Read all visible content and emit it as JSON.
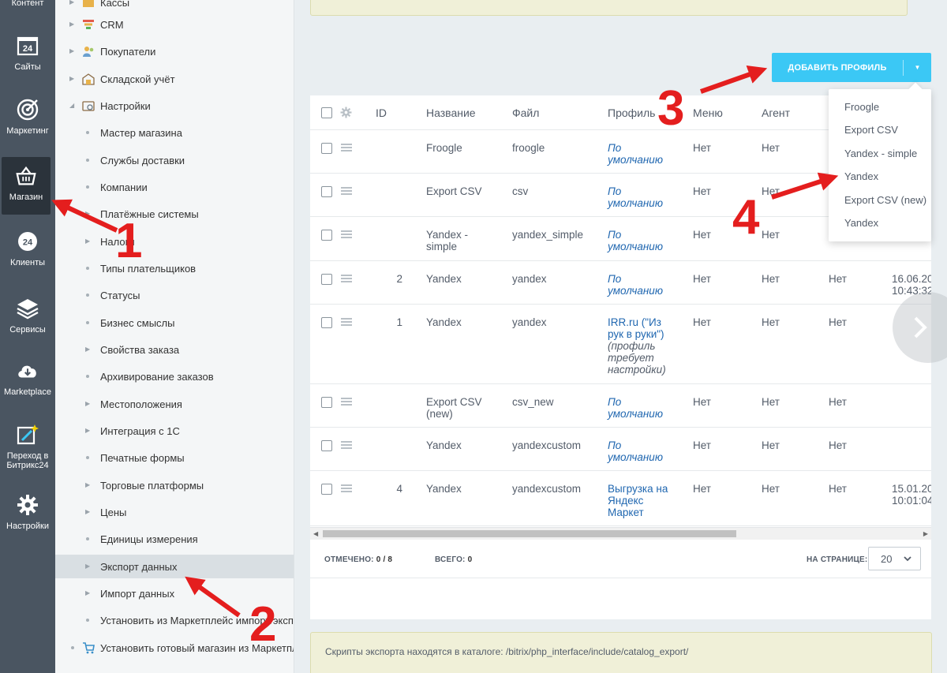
{
  "rail": {
    "items": [
      {
        "label": "Контент",
        "icon": "content-icon"
      },
      {
        "label": "Сайты",
        "icon": "sites-24-icon"
      },
      {
        "label": "Маркетинг",
        "icon": "target-icon"
      },
      {
        "label": "Магазин",
        "icon": "basket-icon",
        "active": true
      },
      {
        "label": "Клиенты",
        "icon": "clients-24-icon"
      },
      {
        "label": "Сервисы",
        "icon": "layers-icon"
      },
      {
        "label": "Marketplace",
        "icon": "cloud-download-icon"
      },
      {
        "label": "Переход в Битрикс24",
        "icon": "magic-wand-icon"
      },
      {
        "label": "Настройки",
        "icon": "gear-icon"
      }
    ]
  },
  "tree": {
    "items": [
      {
        "label": "Кассы",
        "level": 0,
        "type": "folder"
      },
      {
        "label": "CRM",
        "level": 0,
        "type": "folder"
      },
      {
        "label": "Покупатели",
        "level": 0,
        "type": "folder"
      },
      {
        "label": "Складской учёт",
        "level": 0,
        "type": "folder"
      },
      {
        "label": "Настройки",
        "level": 0,
        "type": "folder-open"
      },
      {
        "label": "Мастер магазина",
        "level": 1,
        "type": "leaf"
      },
      {
        "label": "Службы доставки",
        "level": 1,
        "type": "leaf"
      },
      {
        "label": "Компании",
        "level": 1,
        "type": "leaf"
      },
      {
        "label": "Платёжные системы",
        "level": 1,
        "type": "branch"
      },
      {
        "label": "Налоги",
        "level": 1,
        "type": "branch"
      },
      {
        "label": "Типы плательщиков",
        "level": 1,
        "type": "leaf"
      },
      {
        "label": "Статусы",
        "level": 1,
        "type": "leaf"
      },
      {
        "label": "Бизнес смыслы",
        "level": 1,
        "type": "leaf"
      },
      {
        "label": "Свойства заказа",
        "level": 1,
        "type": "branch"
      },
      {
        "label": "Архивирование заказов",
        "level": 1,
        "type": "leaf"
      },
      {
        "label": "Местоположения",
        "level": 1,
        "type": "branch"
      },
      {
        "label": "Интеграция с 1С",
        "level": 1,
        "type": "branch"
      },
      {
        "label": "Печатные формы",
        "level": 1,
        "type": "leaf"
      },
      {
        "label": "Торговые платформы",
        "level": 1,
        "type": "branch"
      },
      {
        "label": "Цены",
        "level": 1,
        "type": "branch"
      },
      {
        "label": "Единицы измерения",
        "level": 1,
        "type": "leaf"
      },
      {
        "label": "Экспорт данных",
        "level": 1,
        "type": "branch",
        "selected": true
      },
      {
        "label": "Импорт данных",
        "level": 1,
        "type": "branch"
      },
      {
        "label": "Установить из Маркетплейс импорт/экспорт",
        "level": 1,
        "type": "leaf"
      },
      {
        "label": "Установить готовый магазин из Маркетплейс",
        "level": 0,
        "type": "cart"
      }
    ]
  },
  "toolbar": {
    "add_profile_label": "ДОБАВИТЬ ПРОФИЛЬ"
  },
  "dropdown": {
    "items": [
      "Froogle",
      "Export CSV",
      "Yandex - simple",
      "Yandex",
      "Export CSV (new)",
      "Yandex"
    ]
  },
  "grid": {
    "columns": [
      "ID",
      "Название",
      "Файл",
      "Профиль",
      "Меню",
      "Агент"
    ],
    "rows": [
      {
        "id": "",
        "name": "Froogle",
        "file": "froogle",
        "profile": "По умолчанию",
        "profile_default": true,
        "menu": "Нет",
        "agent": "Нет",
        "extra": "",
        "date": ""
      },
      {
        "id": "",
        "name": "Export CSV",
        "file": "csv",
        "profile": "По умолчанию",
        "profile_default": true,
        "menu": "Нет",
        "agent": "Нет",
        "extra": "",
        "date": ""
      },
      {
        "id": "",
        "name": "Yandex - simple",
        "file": "yandex_simple",
        "profile": "По умолчанию",
        "profile_default": true,
        "menu": "Нет",
        "agent": "Нет",
        "extra": "",
        "date": ""
      },
      {
        "id": "2",
        "name": "Yandex",
        "file": "yandex",
        "profile": "По умолчанию",
        "profile_default": true,
        "menu": "Нет",
        "agent": "Нет",
        "extra": "Нет",
        "date": "16.06.20 10:43:32"
      },
      {
        "id": "1",
        "name": "Yandex",
        "file": "yandex",
        "profile": "IRR.ru (\"Из рук в руки\")",
        "profile_note": "(профиль требует настройки)",
        "profile_default": false,
        "menu": "Нет",
        "agent": "Нет",
        "extra": "Нет",
        "date": ""
      },
      {
        "id": "",
        "name": "Export CSV (new)",
        "file": "csv_new",
        "profile": "По умолчанию",
        "profile_default": true,
        "menu": "Нет",
        "agent": "Нет",
        "extra": "Нет",
        "date": ""
      },
      {
        "id": "",
        "name": "Yandex",
        "file": "yandexcustom",
        "profile": "По умолчанию",
        "profile_default": true,
        "menu": "Нет",
        "agent": "Нет",
        "extra": "Нет",
        "date": ""
      },
      {
        "id": "4",
        "name": "Yandex",
        "file": "yandexcustom",
        "profile": "Выгрузка на Яндекс Маркет",
        "profile_default": false,
        "menu": "Нет",
        "agent": "Нет",
        "extra": "Нет",
        "date": "15.01.20 10:01:04"
      }
    ]
  },
  "footer": {
    "checked_label": "ОТМЕЧЕНО:",
    "checked_value": "0 / 8",
    "total_label": "ВСЕГО:",
    "total_value": "0",
    "per_page_label": "НА СТРАНИЦЕ:",
    "per_page_value": "20"
  },
  "notice_bottom": "Скрипты экспорта находятся в каталоге: /bitrix/php_interface/include/catalog_export/",
  "annotations": [
    "1",
    "2",
    "3",
    "4"
  ],
  "colors": {
    "accent": "#3bc8f5",
    "rail": "#4a5561",
    "annotation": "#e41e1e",
    "link": "#2067b0"
  }
}
